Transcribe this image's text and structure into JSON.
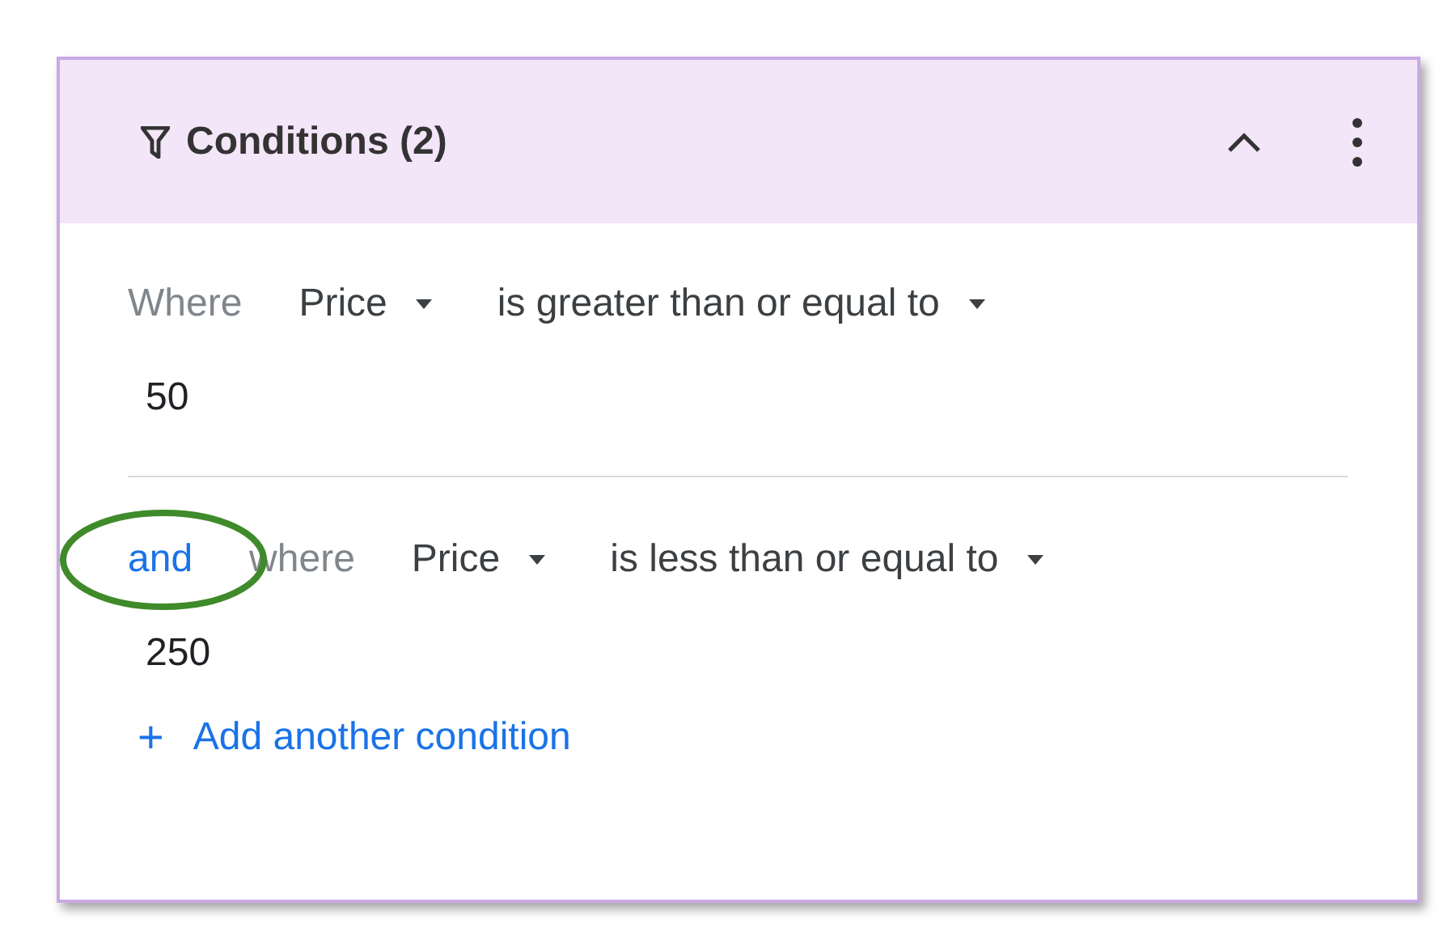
{
  "panel": {
    "title": "Conditions (2)",
    "expanded": true
  },
  "conditions": [
    {
      "label": "Where",
      "field": "Price",
      "operator": "is greater than or equal to",
      "value": "50"
    },
    {
      "conjunction": "and",
      "label": "where",
      "field": "Price",
      "operator": "is less than or equal to",
      "value": "250",
      "circled": true
    }
  ],
  "add_link": {
    "icon": "+",
    "label": "Add another condition"
  }
}
